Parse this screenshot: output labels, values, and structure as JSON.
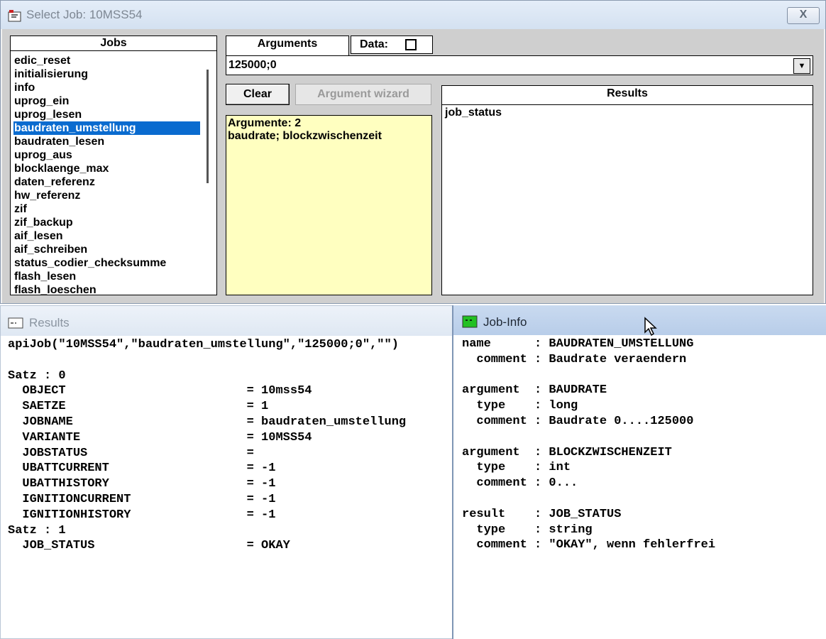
{
  "select_window": {
    "title": "Select Job: 10MSS54",
    "close_label": "X",
    "jobs_header": "Jobs",
    "jobs": [
      "edic_reset",
      "initialisierung",
      "info",
      "uprog_ein",
      "uprog_lesen",
      "baudraten_umstellung",
      "baudraten_lesen",
      "uprog_aus",
      "blocklaenge_max",
      "daten_referenz",
      "hw_referenz",
      "zif",
      "zif_backup",
      "aif_lesen",
      "aif_schreiben",
      "status_codier_checksumme",
      "flash_lesen",
      "flash_loeschen"
    ],
    "selected_job_index": 5,
    "arguments_tab": "Arguments",
    "data_tab": "Data:",
    "data_checked": false,
    "argument_value": "125000;0",
    "clear_label": "Clear",
    "wizard_label": "Argument wizard",
    "argument_info_line1": "Argumente:  2",
    "argument_info_line2": "baudrate; blockzwischenzeit",
    "results_header": "Results",
    "results_items": [
      "job_status"
    ]
  },
  "results_window": {
    "title": "Results",
    "lines": [
      "apiJob(\"10MSS54\",\"baudraten_umstellung\",\"125000;0\",\"\")",
      "",
      "Satz : 0",
      "  OBJECT                         = 10mss54",
      "  SAETZE                         = 1",
      "  JOBNAME                        = baudraten_umstellung",
      "  VARIANTE                       = 10MSS54",
      "  JOBSTATUS                      =",
      "  UBATTCURRENT                   = -1",
      "  UBATTHISTORY                   = -1",
      "  IGNITIONCURRENT                = -1",
      "  IGNITIONHISTORY                = -1",
      "Satz : 1",
      "  JOB_STATUS                     = OKAY"
    ]
  },
  "jobinfo_window": {
    "title": "Job-Info",
    "lines": [
      "name      : BAUDRATEN_UMSTELLUNG",
      "  comment : Baudrate veraendern",
      "",
      "argument  : BAUDRATE",
      "  type    : long",
      "  comment : Baudrate 0....125000",
      "",
      "argument  : BLOCKZWISCHENZEIT",
      "  type    : int",
      "  comment : 0...",
      "",
      "result    : JOB_STATUS",
      "  type    : string",
      "  comment : \"OKAY\", wenn fehlerfrei"
    ]
  },
  "colors": {
    "selection": "#0a6bcf",
    "argument_box": "#ffffc0",
    "jobinfo_icon": "#22c022"
  }
}
